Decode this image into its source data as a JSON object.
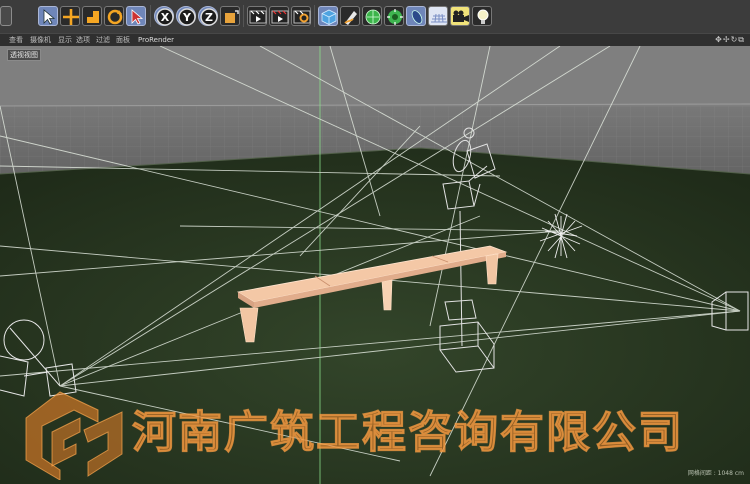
{
  "window": {
    "title": ""
  },
  "toolbar": {
    "tools": [
      "select-arrow",
      "move",
      "scale",
      "rotate",
      "live-selection",
      "x-axis",
      "y-axis",
      "z-axis",
      "coordinate-system",
      "render-view",
      "render-to-picture-viewer",
      "render-settings",
      "cube",
      "pen",
      "subdivision",
      "deformer",
      "environment",
      "floor",
      "camera",
      "light"
    ],
    "x_label": "X",
    "y_label": "Y",
    "z_label": "Z"
  },
  "menubar": {
    "items": [
      "查看",
      "摄像机",
      "显示",
      "选项",
      "过滤",
      "面板",
      "ProRender"
    ],
    "nav_icons": [
      "✥",
      "✢",
      "↻",
      "⧉"
    ]
  },
  "viewport": {
    "label": "透视视图",
    "grid_spacing": "网格间距 : 1048 cm",
    "colors": {
      "floor": "#2b3a22",
      "wall": "#6e6e6e",
      "wireframe": "#e6e6e6",
      "bench": "#f3c3a1"
    }
  },
  "watermark": {
    "text": "河南广筑工程咨询有限公司",
    "color": "#e87e26"
  }
}
